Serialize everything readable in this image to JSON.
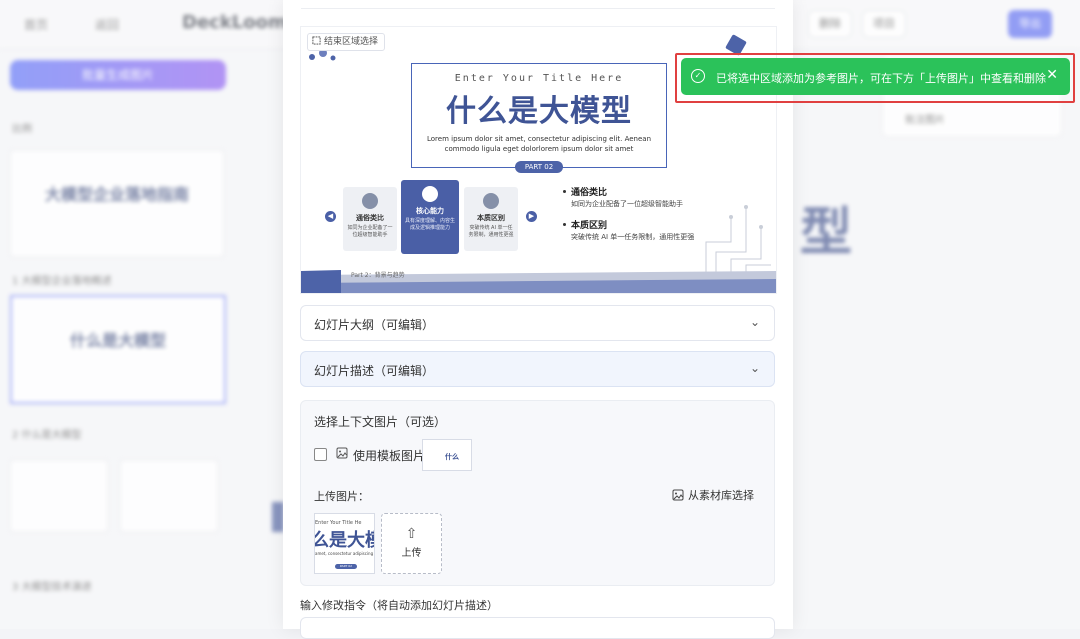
{
  "background": {
    "topbar": [
      "首页",
      "返回"
    ],
    "title": "DeckLoom - [",
    "buttons": [
      "删除",
      "项目",
      "导出"
    ],
    "generate_label": "批量生成图片",
    "sidebar_section": "比例",
    "thumb_titles": [
      "大模型企业落地指南",
      "什么是大模型"
    ],
    "captions": [
      "1 大模型企业落地概述",
      "2 什么是大模型",
      "3 大模型技术演进"
    ],
    "main_title": "型",
    "panel_text": "批注图片"
  },
  "slide": {
    "region_chip": "结束区域选择",
    "subtitle": "Enter Your Title Here",
    "title": "什么是大模型",
    "lorem": "Lorem ipsum dolor sit amet, consectetur adipiscing elit. Aenean commodo ligula eget dolorlorem ipsum dolor sit amet",
    "part": "PART 02",
    "cards": [
      {
        "title": "通俗类比",
        "desc": "如同为企业配备了一位超级智能助手"
      },
      {
        "title": "核心能力",
        "desc": "具有深度理解、内容生成及逻辑推理能力"
      },
      {
        "title": "本质区别",
        "desc": "突破传统 AI 单一任务限制，通用性更强"
      }
    ],
    "bullets": [
      {
        "title": "通俗类比",
        "desc": "如同为企业配备了一位超级智能助手"
      },
      {
        "title": "本质区别",
        "desc": "突破传统 AI 单一任务限制，通用性更强"
      }
    ],
    "footer": "Part 2：背景与趋势"
  },
  "accordions": {
    "outline": "幻灯片大纲（可编辑）",
    "description": "幻灯片描述（可编辑）"
  },
  "context": {
    "title": "选择上下文图片（可选）",
    "use_template": "使用模板图片",
    "template_thumb_text": "什么",
    "upload_label": "上传图片：",
    "library_link": "从素材库选择",
    "upload_button": "上传",
    "thumb_sub": "Enter Your Title He",
    "thumb_title": "么是大模",
    "thumb_lorem": "amet, consectetur adipiscing",
    "thumb_part": "PART 02"
  },
  "instruction_label": "输入修改指令（将自动添加幻灯片描述）",
  "toast": {
    "message": "已将选中区域添加为参考图片，可在下方「上传图片」中查看和删除",
    "close": "✕",
    "color": "#2bc25a"
  }
}
